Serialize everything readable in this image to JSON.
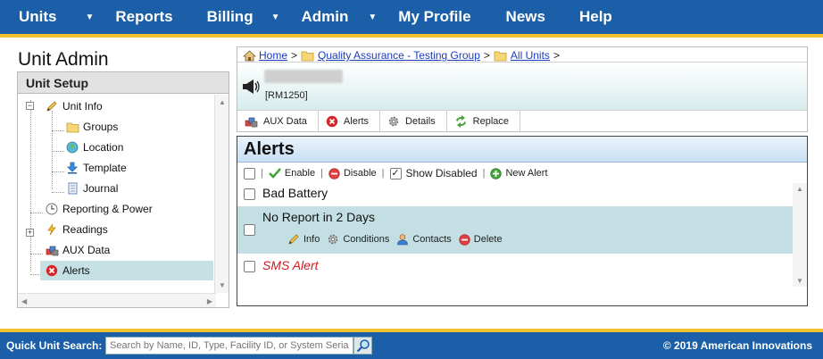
{
  "nav": {
    "items": [
      {
        "label": "Units",
        "has_caret": true
      },
      {
        "label": "Reports",
        "has_caret": false
      },
      {
        "label": "Billing",
        "has_caret": true
      },
      {
        "label": "Admin",
        "has_caret": true
      },
      {
        "label": "My Profile",
        "has_caret": false
      },
      {
        "label": "News",
        "has_caret": false
      },
      {
        "label": "Help",
        "has_caret": false
      }
    ],
    "caret_glyph": "▼"
  },
  "left": {
    "title": "Unit Admin",
    "panel_header": "Unit Setup",
    "tree": [
      {
        "label": "Unit Info",
        "icon": "pencil-icon"
      },
      {
        "label": "Groups",
        "icon": "folder-icon"
      },
      {
        "label": "Location",
        "icon": "globe-icon"
      },
      {
        "label": "Template",
        "icon": "download-icon"
      },
      {
        "label": "Journal",
        "icon": "journal-icon"
      },
      {
        "label": "Reporting & Power",
        "icon": "clock-icon"
      },
      {
        "label": "Readings",
        "icon": "lightning-icon"
      },
      {
        "label": "AUX Data",
        "icon": "aux-data-icon"
      },
      {
        "label": "Alerts",
        "icon": "alert-x-icon"
      }
    ],
    "expander_minus": "−",
    "expander_plus": "+"
  },
  "breadcrumb": {
    "items": [
      "Home",
      "Quality Assurance - Testing Group",
      "All Units"
    ],
    "separator": ">"
  },
  "unit": {
    "id_label": "[RM1250]"
  },
  "tabs": [
    {
      "label": "AUX Data",
      "icon": "aux-data-icon"
    },
    {
      "label": "Alerts",
      "icon": "alert-x-icon"
    },
    {
      "label": "Details",
      "icon": "gear-icon"
    },
    {
      "label": "Replace",
      "icon": "replace-icon"
    }
  ],
  "alerts": {
    "title": "Alerts",
    "toolbar": {
      "enable": "Enable",
      "disable": "Disable",
      "show_disabled": "Show Disabled",
      "new_alert": "New Alert",
      "pipe": "|"
    },
    "rows": [
      {
        "label": "Bad Battery"
      },
      {
        "label": "No Report in 2 Days"
      },
      {
        "label": "SMS Alert"
      }
    ],
    "row_actions": {
      "info": "Info",
      "conditions": "Conditions",
      "contacts": "Contacts",
      "delete": "Delete"
    }
  },
  "footer": {
    "quick_search_label": "Quick Unit Search:",
    "search_placeholder": "Search by Name, ID, Type, Facility ID, or System Serial",
    "copyright": "© 2019 American Innovations"
  },
  "colors": {
    "nav_bg": "#1a5fa8",
    "gold": "#f2c12e",
    "selected_row": "#c6e1e4",
    "sms_alert": "#d2181f"
  }
}
